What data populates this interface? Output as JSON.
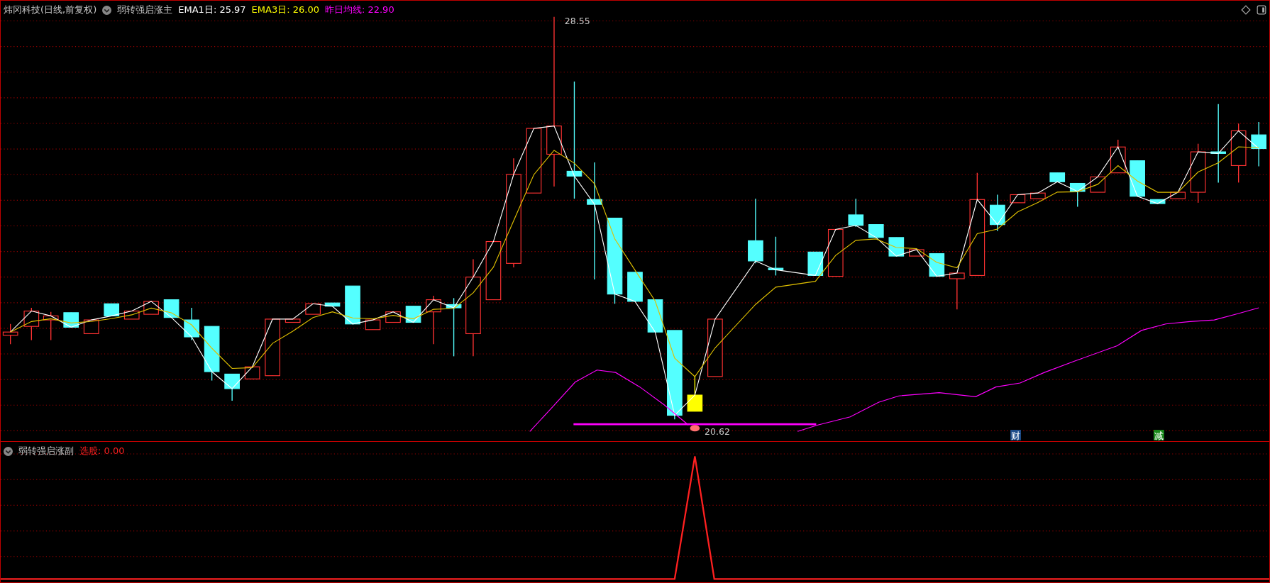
{
  "main_panel": {
    "title": "炜冈科技(日线,前复权)",
    "indicator": "弱转强启涨主",
    "legend": [
      {
        "text": "EMA1日: 25.97",
        "color": "#ffffff"
      },
      {
        "text": "EMA3日: 26.00",
        "color": "#ffff00"
      },
      {
        "text": "昨日均线: 22.90",
        "color": "#ff00ff"
      }
    ],
    "high_label": "28.55",
    "low_label": "20.62",
    "markers": [
      {
        "text": "财",
        "color": "#1f4e8c"
      },
      {
        "text": "减",
        "color": "#1a8a1a"
      }
    ]
  },
  "sub_panel": {
    "indicator": "弱转强启涨副",
    "legend": [
      {
        "text": "选股: 0.00",
        "color": "#ff2020"
      }
    ]
  }
}
